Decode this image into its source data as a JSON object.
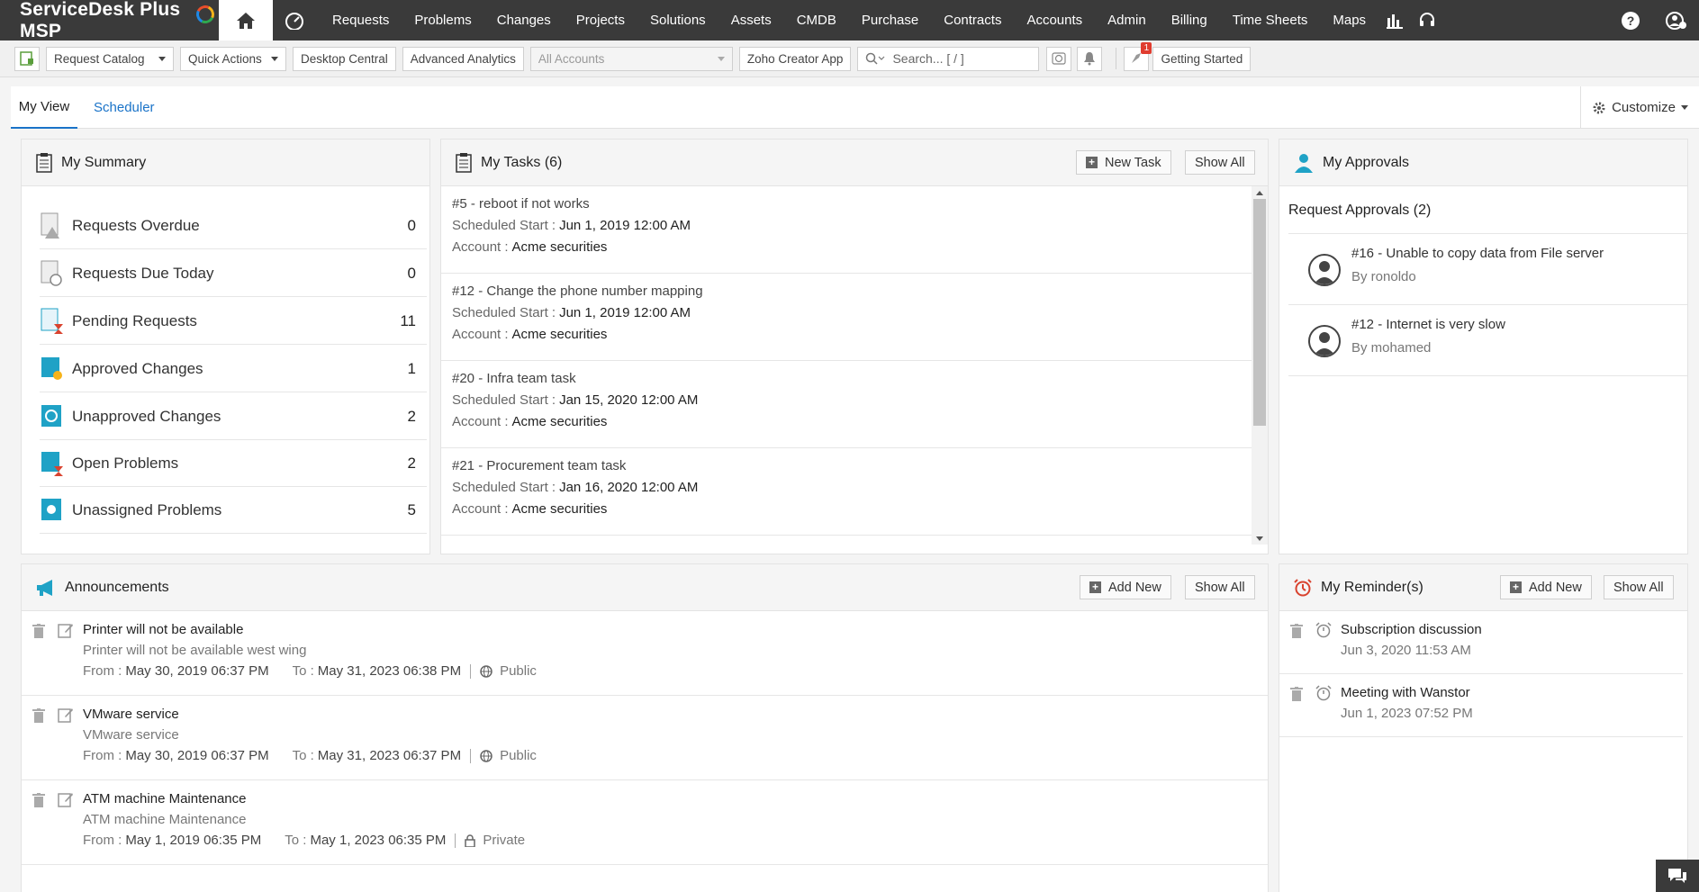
{
  "app": {
    "title": "ServiceDesk Plus MSP"
  },
  "nav": {
    "items": [
      "Requests",
      "Problems",
      "Changes",
      "Projects",
      "Solutions",
      "Assets",
      "CMDB",
      "Purchase",
      "Contracts",
      "Accounts",
      "Admin",
      "Billing",
      "Time Sheets",
      "Maps"
    ]
  },
  "toolbar": {
    "request_catalog": "Request Catalog",
    "quick_actions": "Quick Actions",
    "desktop_central": "Desktop Central",
    "advanced_analytics": "Advanced Analytics",
    "all_accounts": "All Accounts",
    "zoho_creator": "Zoho Creator App",
    "search_placeholder": "Search... [ / ]",
    "notification_count": "1",
    "getting_started": "Getting Started"
  },
  "tabs": {
    "my_view": "My View",
    "scheduler": "Scheduler",
    "customize": "Customize"
  },
  "summary": {
    "title": "My Summary",
    "rows": [
      {
        "label": "Requests Overdue",
        "count": "0"
      },
      {
        "label": "Requests Due Today",
        "count": "0"
      },
      {
        "label": "Pending Requests",
        "count": "11"
      },
      {
        "label": "Approved Changes",
        "count": "1"
      },
      {
        "label": "Unapproved Changes",
        "count": "2"
      },
      {
        "label": "Open Problems",
        "count": "2"
      },
      {
        "label": "Unassigned Problems",
        "count": "5"
      }
    ]
  },
  "tasks": {
    "title": "My Tasks (6)",
    "new_task": "New Task",
    "show_all": "Show All",
    "start_label": "Scheduled Start :",
    "account_label": "Account :",
    "items": [
      {
        "title": "#5 - reboot if not works",
        "start": "Jun 1, 2019 12:00 AM",
        "account": "Acme securities"
      },
      {
        "title": "#12 - Change the phone number mapping",
        "start": "Jun 1, 2019 12:00 AM",
        "account": "Acme securities"
      },
      {
        "title": "#20 - Infra team task",
        "start": "Jan 15, 2020 12:00 AM",
        "account": "Acme securities"
      },
      {
        "title": "#21 - Procurement team task",
        "start": "Jan 16, 2020 12:00 AM",
        "account": "Acme securities"
      }
    ]
  },
  "approvals": {
    "title": "My Approvals",
    "subtitle": "Request Approvals (2)",
    "items": [
      {
        "title": "#16 - Unable to copy data from File server",
        "by": "By ronoldo"
      },
      {
        "title": "#12 - Internet is very slow",
        "by": "By mohamed"
      }
    ]
  },
  "announcements": {
    "title": "Announcements",
    "add_new": "Add New",
    "show_all": "Show All",
    "from_label": "From :",
    "to_label": "To :",
    "items": [
      {
        "title": "Printer will not be available",
        "desc": "Printer will not be available west wing",
        "from": "May 30, 2019 06:37 PM",
        "to": "May 31, 2023 06:38 PM",
        "visibility": "Public"
      },
      {
        "title": "VMware service",
        "desc": "VMware service",
        "from": "May 30, 2019 06:37 PM",
        "to": "May 31, 2023 06:37 PM",
        "visibility": "Public"
      },
      {
        "title": "ATM machine Maintenance",
        "desc": "ATM machine Maintenance",
        "from": "May 1, 2019 06:35 PM",
        "to": "May 1, 2023 06:35 PM",
        "visibility": "Private"
      }
    ]
  },
  "reminders": {
    "title": "My Reminder(s)",
    "add_new": "Add New",
    "show_all": "Show All",
    "items": [
      {
        "title": "Subscription discussion",
        "date": "Jun 3, 2020 11:53 AM"
      },
      {
        "title": "Meeting with Wanstor",
        "date": "Jun 1, 2023 07:52 PM"
      }
    ]
  },
  "colors": {
    "nav_bg": "#3a3a3a",
    "accent": "#1a73c8",
    "teal": "#1fa2c6",
    "reminder_red": "#d9432f"
  }
}
